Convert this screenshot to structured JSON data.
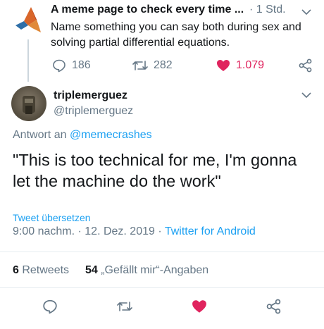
{
  "parent": {
    "name": "A meme page to check every time ...",
    "time": "· 1 Std.",
    "text": "Name something you can say both during sex and solving partial differential equations.",
    "replies": "186",
    "retweets": "282",
    "likes": "1.079"
  },
  "reply": {
    "name": "triplemerguez",
    "handle": "@triplemerguez",
    "reply_prefix": "Antwort an ",
    "reply_mention": "@memecrashes",
    "text": "\"This is too technical for me, I'm gonna let the machine do the work\"",
    "translate": "Tweet übersetzen",
    "timestamp": "9:00 nachm. · 12. Dez. 2019 · ",
    "client": "Twitter for Android"
  },
  "stats": {
    "retweet_count": "6",
    "retweet_label": " Retweets",
    "like_count": "54",
    "like_label": " „Gefällt mir“-Angaben"
  },
  "colors": {
    "accent": "#1da1f2",
    "like": "#e0245e",
    "muted": "#657786",
    "text": "#14171a"
  },
  "icons": [
    "matlab-logo-icon",
    "chevron-down-icon",
    "reply-icon",
    "retweet-icon",
    "heart-icon",
    "share-icon"
  ]
}
